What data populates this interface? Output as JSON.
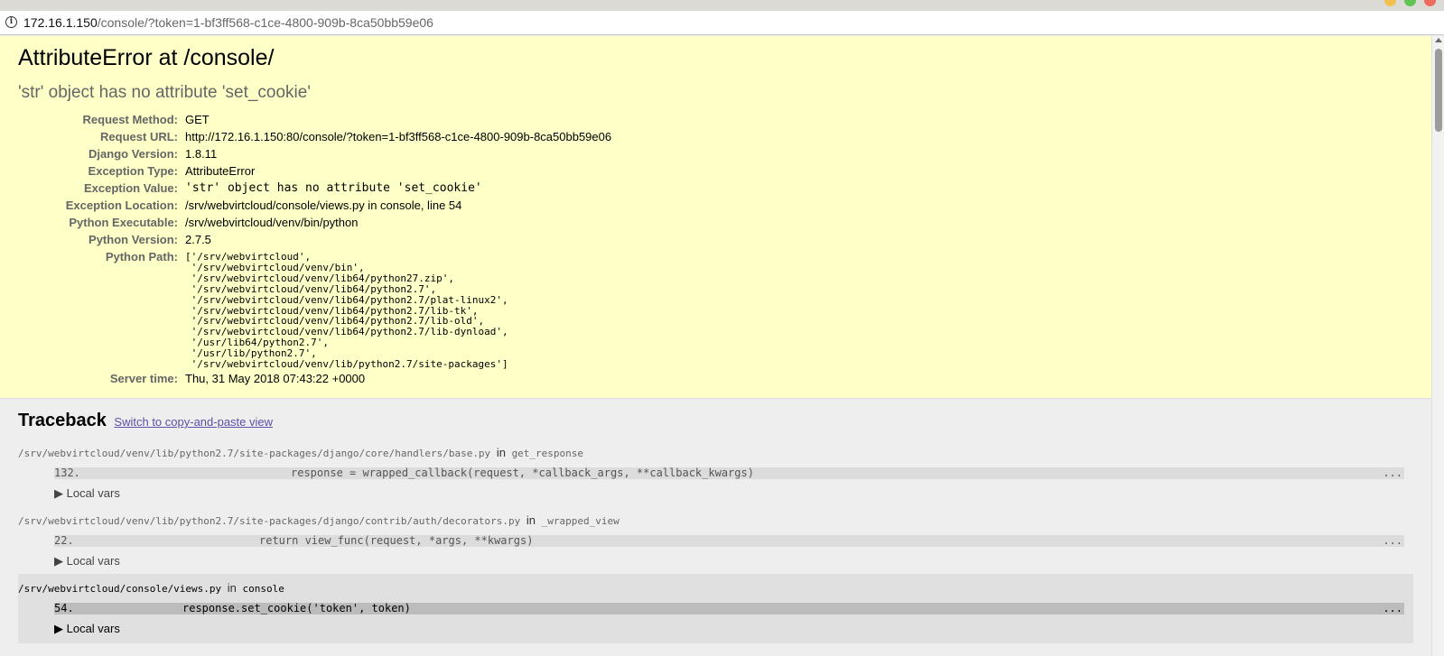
{
  "browser": {
    "url_host": "172.16.1.150",
    "url_path": "/console/?token=1-bf3ff568-c1ce-4800-909b-8ca50bb59e06"
  },
  "summary": {
    "title": "AttributeError at /console/",
    "subtitle": "'str' object has no attribute 'set_cookie'",
    "rows": [
      {
        "label": "Request Method:",
        "value": "GET"
      },
      {
        "label": "Request URL:",
        "value": "http://172.16.1.150:80/console/?token=1-bf3ff568-c1ce-4800-909b-8ca50bb59e06"
      },
      {
        "label": "Django Version:",
        "value": "1.8.11"
      },
      {
        "label": "Exception Type:",
        "value": "AttributeError"
      },
      {
        "label": "Exception Value:",
        "value": "'str' object has no attribute 'set_cookie'"
      },
      {
        "label": "Exception Location:",
        "value": "/srv/webvirtcloud/console/views.py in console, line 54"
      },
      {
        "label": "Python Executable:",
        "value": "/srv/webvirtcloud/venv/bin/python"
      },
      {
        "label": "Python Version:",
        "value": "2.7.5"
      },
      {
        "label": "Python Path:",
        "value": "['/srv/webvirtcloud',\n '/srv/webvirtcloud/venv/bin',\n '/srv/webvirtcloud/venv/lib64/python27.zip',\n '/srv/webvirtcloud/venv/lib64/python2.7',\n '/srv/webvirtcloud/venv/lib64/python2.7/plat-linux2',\n '/srv/webvirtcloud/venv/lib64/python2.7/lib-tk',\n '/srv/webvirtcloud/venv/lib64/python2.7/lib-old',\n '/srv/webvirtcloud/venv/lib64/python2.7/lib-dynload',\n '/usr/lib64/python2.7',\n '/usr/lib/python2.7',\n '/srv/webvirtcloud/venv/lib/python2.7/site-packages']"
      },
      {
        "label": "Server time:",
        "value": "Thu, 31 May 2018 07:43:22 +0000"
      }
    ]
  },
  "traceback": {
    "heading": "Traceback",
    "switch_link": "Switch to copy-and-paste view",
    "in_word": "in",
    "frames": [
      {
        "file": "/srv/webvirtcloud/venv/lib/python2.7/site-packages/django/core/handlers/base.py",
        "function": "get_response",
        "lineno": "132.",
        "code": "response = wrapped_callback(request, *callback_args, **callback_kwargs)",
        "ellipsis": "...",
        "local_vars": "▶ Local vars"
      },
      {
        "file": "/srv/webvirtcloud/venv/lib/python2.7/site-packages/django/contrib/auth/decorators.py",
        "function": "_wrapped_view",
        "lineno": "22.",
        "code": "return view_func(request, *args, **kwargs)",
        "ellipsis": "...",
        "local_vars": "▶ Local vars"
      },
      {
        "file": "/srv/webvirtcloud/console/views.py",
        "function": "console",
        "lineno": "54.",
        "code": "response.set_cookie('token', token)",
        "ellipsis": "...",
        "local_vars": "▶ Local vars"
      }
    ]
  },
  "colors": {
    "summary_bg": "#ffffc8",
    "page_bg": "#eeeeee",
    "link": "#5b50a8"
  }
}
